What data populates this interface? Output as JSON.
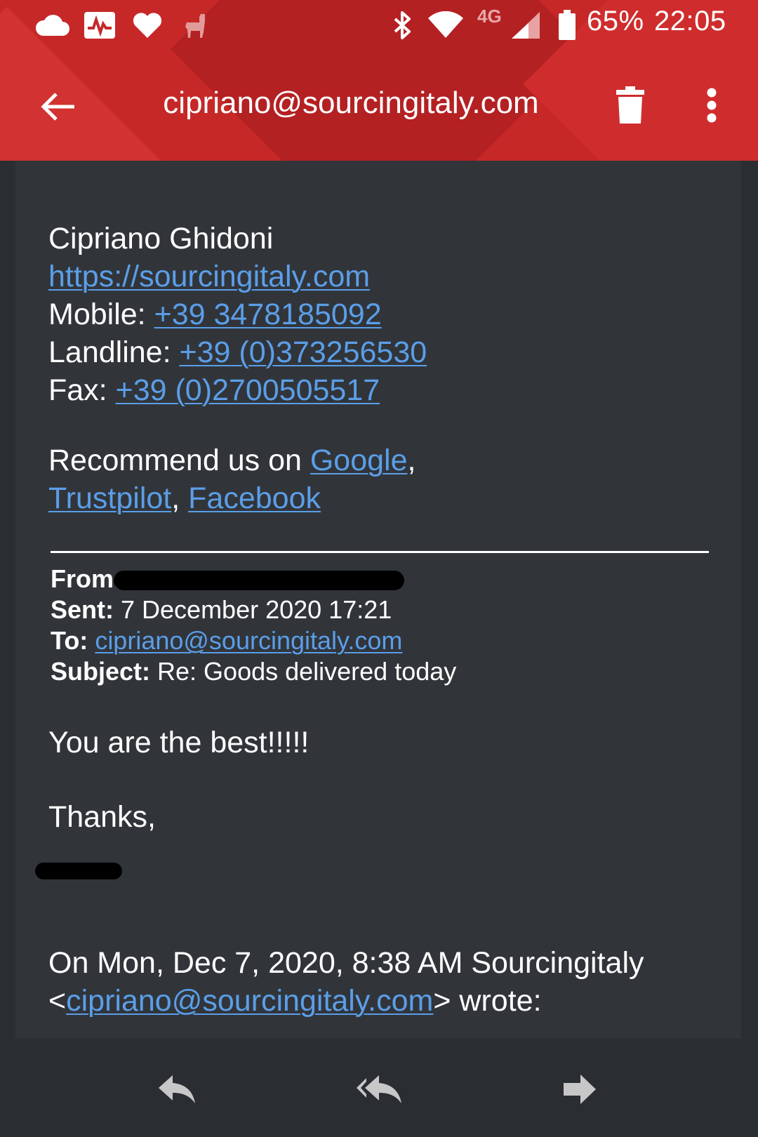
{
  "status_bar": {
    "battery_percent": "65%",
    "time": "22:05",
    "network_type": "4G",
    "icons": [
      "cloud-icon",
      "activity-icon",
      "heart-icon",
      "llama-icon",
      "bluetooth-icon",
      "wifi-icon",
      "signal-icon",
      "battery-icon"
    ]
  },
  "app_bar": {
    "title": "cipriano@sourcingitaly.com",
    "icons": [
      "back-arrow-icon",
      "trash-icon",
      "more-vert-icon"
    ]
  },
  "signature": {
    "name": "Cipriano Ghidoni",
    "website": "https://sourcingitaly.com",
    "mobile_label": "Mobile: ",
    "mobile_value": "+39 3478185092",
    "landline_label": "Landline: ",
    "landline_value": "+39 (0)373256530",
    "fax_label": "Fax: ",
    "fax_value": "+39 (0)2700505517",
    "recommend_prefix": "Recommend us on ",
    "google": "Google",
    "comma": ",",
    "trustpilot": "Trustpilot",
    "comma2": ", ",
    "facebook": "Facebook"
  },
  "quoted_header": {
    "from_label": "From:",
    "sent_label": "Sent:",
    "sent_value": " 7 December 2020 17:21",
    "to_label": "To:",
    "to_value": "cipriano@sourcingitaly.com",
    "subject_label": "Subject:",
    "subject_value": " Re: Goods delivered today"
  },
  "body": {
    "line1": "You are the best!!!!!",
    "line2": "Thanks,",
    "reply_intro": "On Mon, Dec 7, 2020, 8:38 AM Sourcingitaly",
    "reply_lt": "<",
    "reply_email": "cipriano@sourcingitaly.com",
    "reply_suffix": "> wrote:"
  },
  "bottom_bar": {
    "actions": [
      "reply-icon",
      "reply-all-icon",
      "forward-icon"
    ]
  },
  "colors": {
    "header_red": "#c62828",
    "card_bg": "#31353a",
    "link_blue": "#5b9ee8",
    "bottom_bar": "#2a2d31"
  }
}
